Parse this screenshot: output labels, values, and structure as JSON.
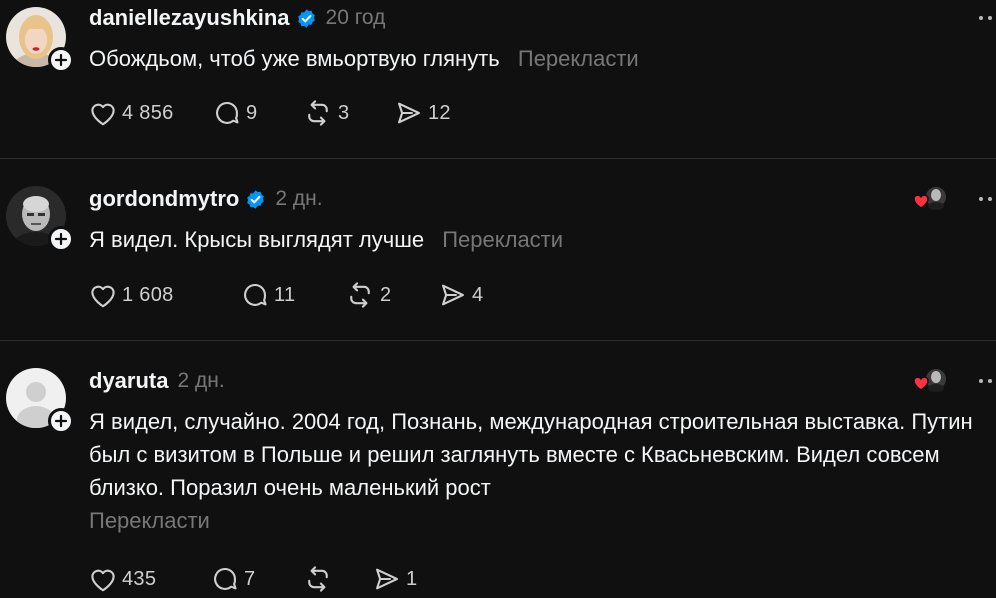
{
  "colors": {
    "background": "#101010",
    "text": "#f3f5f7",
    "muted": "#777777",
    "verified": "#0095f6",
    "like_red": "#ff3040",
    "divider": "#2d2d2d"
  },
  "posts": [
    {
      "username": "daniellezayushkina",
      "verified": true,
      "time": "20 год",
      "text": "Обождьом, чтоб уже вмьортвую глянуть",
      "translate": "Перекласти",
      "likes": "4 856",
      "replies": "9",
      "reposts": "3",
      "shares": "12",
      "liked_by_avatar": false
    },
    {
      "username": "gordondmytro",
      "verified": true,
      "time": "2 дн.",
      "text": "Я видел. Крысы выглядят лучше",
      "translate": "Перекласти",
      "likes": "1 608",
      "replies": "11",
      "reposts": "2",
      "shares": "4",
      "liked_by_avatar": true
    },
    {
      "username": "dyaruta",
      "verified": false,
      "time": "2 дн.",
      "text": "Я видел, случайно. 2004 год, Познань, международная строительная выставка. Путин был с визитом в Польше и решил заглянуть вместе с Квасьневским. Видел совсем близко. Поразил очень маленький рост",
      "translate": "Перекласти",
      "likes": "435",
      "replies": "7",
      "reposts": "",
      "shares": "1",
      "liked_by_avatar": true
    }
  ],
  "icons": {
    "like": "heart-icon",
    "reply": "comment-icon",
    "repost": "repost-icon",
    "share": "send-icon",
    "more": "more-icon",
    "follow": "plus-icon",
    "verified": "verified-badge-icon"
  }
}
